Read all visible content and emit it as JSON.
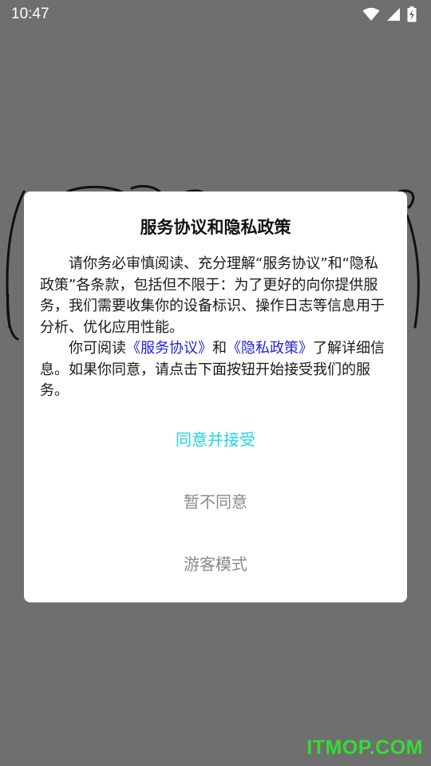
{
  "status_bar": {
    "time": "10:47",
    "icons": [
      "wifi-icon",
      "signal-icon",
      "battery-charging-icon"
    ],
    "color": "#ffffff"
  },
  "dialog": {
    "title": "服务协议和隐私政策",
    "paragraph1": "请你务必审慎阅读、充分理解“服务协议”和“隐私政策”各条款，包括但不限于：为了更好的向你提供服务，我们需要收集你的设备标识、操作日志等信息用于分析、优化应用性能。",
    "paragraph2_prefix": "你可阅读",
    "service_link": "《服务协议》",
    "paragraph2_and": "和",
    "privacy_link": "《隐私政策》",
    "paragraph2_suffix": "了解详细信息。如果你同意，请点击下面按钮开始接受我们的服务。",
    "agree_button": "同意并接受",
    "decline_button": "暂不同意",
    "guest_button": "游客模式",
    "colors": {
      "agree": "#22d3e8",
      "link": "#2222dd",
      "muted": "#8a8a8a"
    }
  },
  "watermark": "ITMOP.COM",
  "colors": {
    "scrim": "#6f6f6f",
    "watermark": "#33dd33"
  }
}
